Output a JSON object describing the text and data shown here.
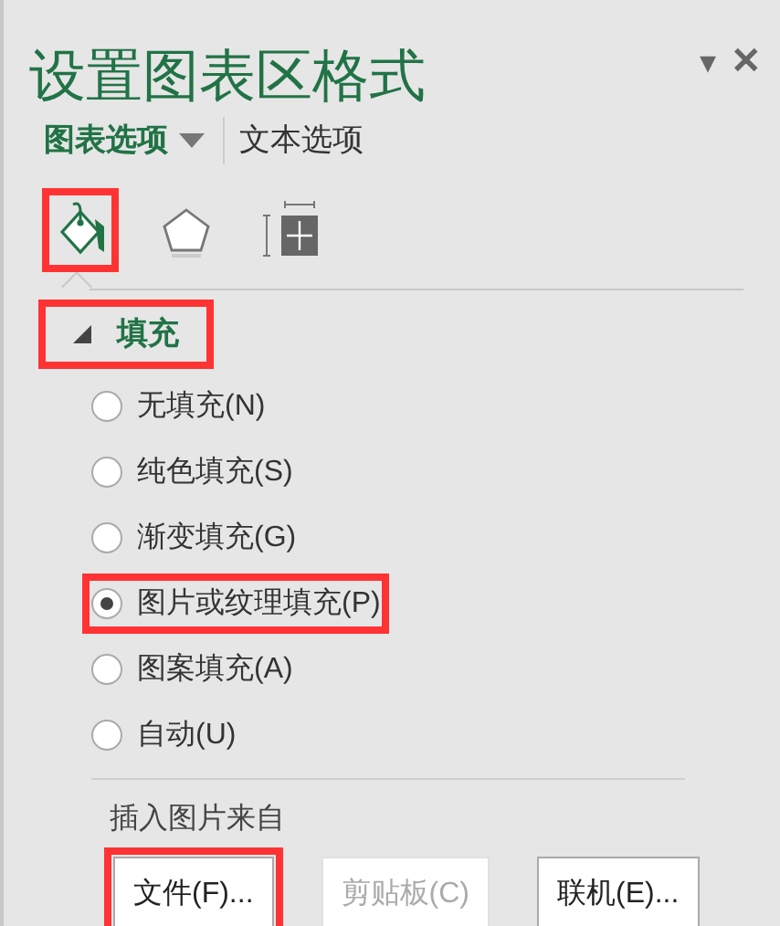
{
  "pane": {
    "title": "设置图表区格式",
    "menu_glyph": "▾",
    "close_glyph": "✕"
  },
  "tabs": [
    {
      "label": "图表选项",
      "selected": true,
      "has_dropdown": true
    },
    {
      "label": "文本选项",
      "selected": false,
      "has_dropdown": false
    }
  ],
  "icon_tabs": [
    {
      "kind": "fill",
      "selected": true,
      "highlighted": true
    },
    {
      "kind": "effects",
      "selected": false,
      "highlighted": false
    },
    {
      "kind": "size",
      "selected": false,
      "highlighted": false
    }
  ],
  "section": {
    "title": "填充",
    "expanded": true,
    "highlighted": true
  },
  "fill_options": [
    {
      "label": "无填充(N)",
      "selected": false,
      "highlighted": false
    },
    {
      "label": "纯色填充(S)",
      "selected": false,
      "highlighted": false
    },
    {
      "label": "渐变填充(G)",
      "selected": false,
      "highlighted": false
    },
    {
      "label": "图片或纹理填充(P)",
      "selected": true,
      "highlighted": true
    },
    {
      "label": "图案填充(A)",
      "selected": false,
      "highlighted": false
    },
    {
      "label": "自动(U)",
      "selected": false,
      "highlighted": false
    }
  ],
  "insert_from": {
    "label": "插入图片来自",
    "buttons": [
      {
        "label": "文件(F)...",
        "disabled": false,
        "highlighted": true
      },
      {
        "label": "剪贴板(C)",
        "disabled": true,
        "highlighted": false
      },
      {
        "label": "联机(E)...",
        "disabled": false,
        "highlighted": false
      }
    ]
  }
}
